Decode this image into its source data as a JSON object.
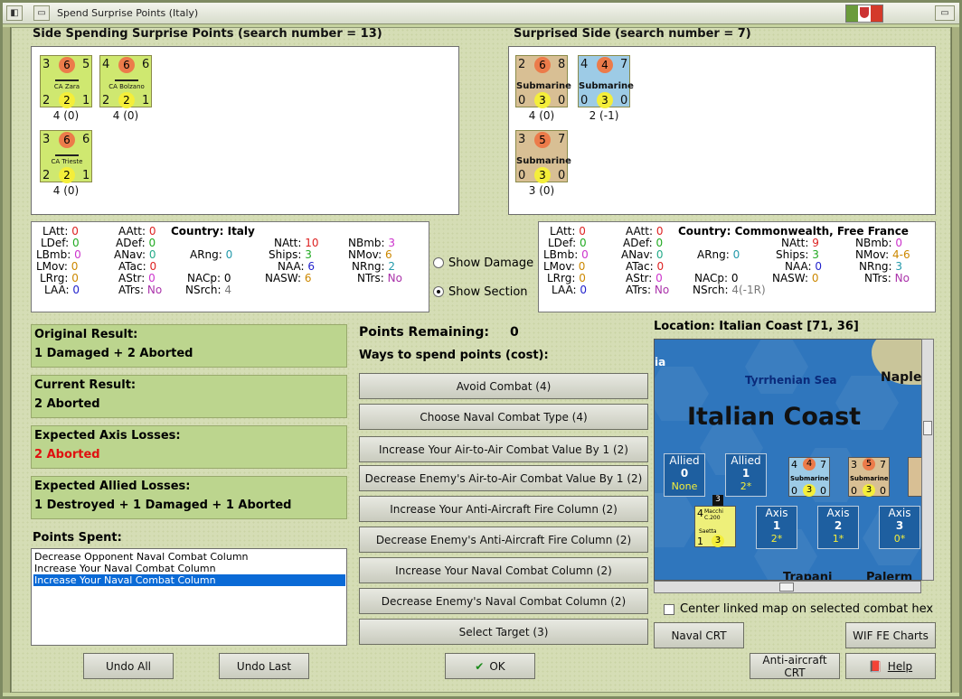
{
  "window": {
    "title": "Spend Surprise Points (Italy)",
    "flag": {
      "left": "#6a9b3a",
      "mid": "#ffffff",
      "right": "#d43a2a"
    }
  },
  "left_side": {
    "title": "Side Spending Surprise Points (search number = 13)",
    "units": [
      {
        "name": "CA Zara",
        "att": "3",
        "mid": "6",
        "def": "5",
        "b1": "2",
        "b2": "2",
        "b3": "1",
        "caption": "4 (0)"
      },
      {
        "name": "CA Bolzano",
        "att": "4",
        "mid": "6",
        "def": "6",
        "b1": "2",
        "b2": "2",
        "b3": "1",
        "caption": "4 (0)"
      },
      {
        "name": "CA Trieste",
        "att": "3",
        "mid": "6",
        "def": "6",
        "b1": "2",
        "b2": "2",
        "b3": "1",
        "caption": "4 (0)"
      }
    ]
  },
  "right_side": {
    "title": "Surprised Side (search number = 7)",
    "units": [
      {
        "name": "Submarine",
        "att": "2",
        "mid": "6",
        "def": "8",
        "b1": "0",
        "b2": "3",
        "b3": "0",
        "caption": "4 (0)"
      },
      {
        "name": "Submarine",
        "att": "4",
        "mid": "4",
        "def": "7",
        "b1": "0",
        "b2": "3",
        "b3": "0",
        "caption": "2 (-1)"
      },
      {
        "name": "Submarine",
        "att": "3",
        "mid": "5",
        "def": "7",
        "b1": "0",
        "b2": "3",
        "b3": "0",
        "caption": "3 (0)"
      }
    ]
  },
  "left_stats": {
    "country_label": "Country:",
    "country": "Italy",
    "LAtt": "0",
    "AAtt": "0",
    "LDef": "0",
    "ADef": "0",
    "LBmb": "0",
    "ANav": "0",
    "ARng": "0",
    "LMov": "0",
    "ATac": "0",
    "LRrg": "0",
    "AStr": "0",
    "LAA": "0",
    "ATrs": "No",
    "NAtt": "10",
    "NBmb": "3",
    "Ships": "3",
    "NMov": "6",
    "NAA": "6",
    "NRng": "2",
    "NACp": "0",
    "NASW": "6",
    "NTrs": "No",
    "NSrch": "4"
  },
  "right_stats": {
    "country_label": "Country:",
    "country": "Commonwealth, Free France",
    "LAtt": "0",
    "AAtt": "0",
    "LDef": "0",
    "ADef": "0",
    "LBmb": "0",
    "ANav": "0",
    "ARng": "0",
    "LMov": "0",
    "ATac": "0",
    "LRrg": "0",
    "AStr": "0",
    "LAA": "0",
    "ATrs": "No",
    "NAtt": "9",
    "NBmb": "0",
    "Ships": "3",
    "NMov": "4-6",
    "NAA": "0",
    "NRng": "3",
    "NACp": "0",
    "NASW": "0",
    "NTrs": "No",
    "NSrch": "4(-1R)"
  },
  "options": {
    "show_damage": "Show Damage",
    "show_section": "Show Section"
  },
  "results": [
    {
      "label": "Original Result:",
      "value": "1 Damaged + 2 Aborted",
      "color": "#111111"
    },
    {
      "label": "Current Result:",
      "value": "2 Aborted",
      "color": "#111111"
    },
    {
      "label": "Expected Axis Losses:",
      "value": "2 Aborted",
      "color": "#e01010"
    },
    {
      "label": "Expected Allied Losses:",
      "value": "1 Destroyed + 1 Damaged + 1 Aborted",
      "color": "#111111"
    }
  ],
  "points": {
    "spent_label": "Points Spent:",
    "remaining_label": "Points Remaining:",
    "remaining": "0",
    "ways_label": "Ways to spend points (cost):",
    "spent_items": [
      "Decrease Opponent Naval Combat Column",
      "Increase Your Naval Combat Column",
      "Increase Your Naval Combat Column"
    ]
  },
  "actions": [
    "Avoid Combat (4)",
    "Choose Naval Combat Type (4)",
    "Increase Your Air-to-Air Combat Value By 1 (2)",
    "Decrease Enemy's Air-to-Air Combat Value By 1 (2)",
    "Increase Your Anti-Aircraft Fire Column (2)",
    "Decrease Enemy's Anti-Aircraft Fire Column (2)",
    "Increase Your Naval Combat Column (2)",
    "Decrease Enemy's Naval Combat Column (2)",
    "Select Target (3)"
  ],
  "map": {
    "location": "Location: Italian Coast [71, 36]",
    "sea": "Tyrrhenian Sea",
    "coast": "Italian Coast",
    "naples": "Naple",
    "ia": "ia",
    "trapani": "Trapani",
    "palermo": "Palerm",
    "allied_boxes": [
      {
        "label": "Allied",
        "num": "0",
        "extra": "None"
      },
      {
        "label": "Allied",
        "num": "1",
        "extra": "2*"
      }
    ],
    "axis_boxes": [
      {
        "label": "Axis",
        "num": "1",
        "extra": "2*"
      },
      {
        "label": "Axis",
        "num": "2",
        "extra": "1*"
      },
      {
        "label": "Axis",
        "num": "3",
        "extra": "0*"
      }
    ],
    "plane": {
      "name": "Macchi C.200",
      "sub": "Saetta",
      "a": "4",
      "b": "1",
      "c": "3",
      "top": "3"
    },
    "center_linked": "Center linked map on selected combat hex"
  },
  "buttons": {
    "undo_all": "Undo All",
    "undo_last": "Undo Last",
    "ok": "OK",
    "naval_crt": "Naval CRT",
    "wif_charts": "WIF FE Charts",
    "aa_crt": "Anti-aircraft CRT",
    "help": "Help"
  }
}
